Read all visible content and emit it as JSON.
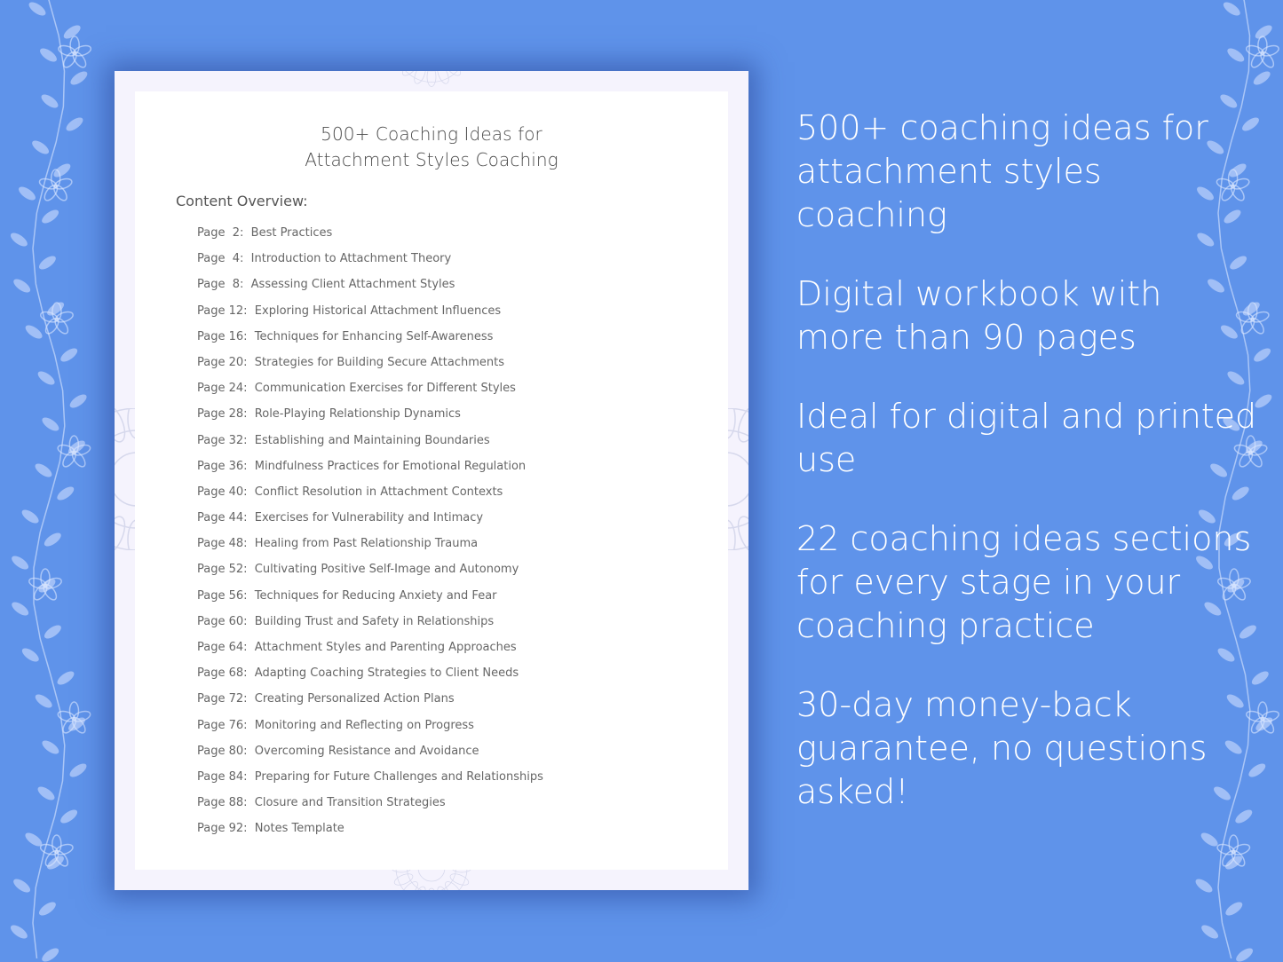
{
  "document": {
    "title_line1": "500+ Coaching Ideas for",
    "title_line2": "Attachment Styles Coaching",
    "overview_label": "Content Overview:",
    "toc": [
      {
        "page": "Page  2:",
        "title": "Best Practices"
      },
      {
        "page": "Page  4:",
        "title": "Introduction to Attachment Theory"
      },
      {
        "page": "Page  8:",
        "title": "Assessing Client Attachment Styles"
      },
      {
        "page": "Page 12:",
        "title": "Exploring Historical Attachment Influences"
      },
      {
        "page": "Page 16:",
        "title": "Techniques for Enhancing Self-Awareness"
      },
      {
        "page": "Page 20:",
        "title": "Strategies for Building Secure Attachments"
      },
      {
        "page": "Page 24:",
        "title": "Communication Exercises for Different Styles"
      },
      {
        "page": "Page 28:",
        "title": "Role-Playing Relationship Dynamics"
      },
      {
        "page": "Page 32:",
        "title": "Establishing and Maintaining Boundaries"
      },
      {
        "page": "Page 36:",
        "title": "Mindfulness Practices for Emotional Regulation"
      },
      {
        "page": "Page 40:",
        "title": "Conflict Resolution in Attachment Contexts"
      },
      {
        "page": "Page 44:",
        "title": "Exercises for Vulnerability and Intimacy"
      },
      {
        "page": "Page 48:",
        "title": "Healing from Past Relationship Trauma"
      },
      {
        "page": "Page 52:",
        "title": "Cultivating Positive Self-Image and Autonomy"
      },
      {
        "page": "Page 56:",
        "title": "Techniques for Reducing Anxiety and Fear"
      },
      {
        "page": "Page 60:",
        "title": "Building Trust and Safety in Relationships"
      },
      {
        "page": "Page 64:",
        "title": "Attachment Styles and Parenting Approaches"
      },
      {
        "page": "Page 68:",
        "title": "Adapting Coaching Strategies to Client Needs"
      },
      {
        "page": "Page 72:",
        "title": "Creating Personalized Action Plans"
      },
      {
        "page": "Page 76:",
        "title": "Monitoring and Reflecting on Progress"
      },
      {
        "page": "Page 80:",
        "title": "Overcoming Resistance and Avoidance"
      },
      {
        "page": "Page 84:",
        "title": "Preparing for Future Challenges and Relationships"
      },
      {
        "page": "Page 88:",
        "title": "Closure and Transition Strategies"
      },
      {
        "page": "Page 92:",
        "title": "Notes Template"
      }
    ]
  },
  "features": [
    "500+ coaching ideas for attachment styles coaching",
    "Digital workbook with more than 90 pages",
    "Ideal for digital and printed use",
    "22 coaching ideas sections for every stage in your coaching practice",
    "30-day money-back guarantee, no questions asked!"
  ],
  "colors": {
    "background": "#5f93ea",
    "page_border": "#f5f3fd",
    "page_inner": "#ffffff",
    "feature_text": "#ffffff"
  },
  "icons": {
    "vine_left": "floral-vine-icon",
    "vine_right": "floral-vine-icon",
    "mandala": "mandala-icon"
  }
}
